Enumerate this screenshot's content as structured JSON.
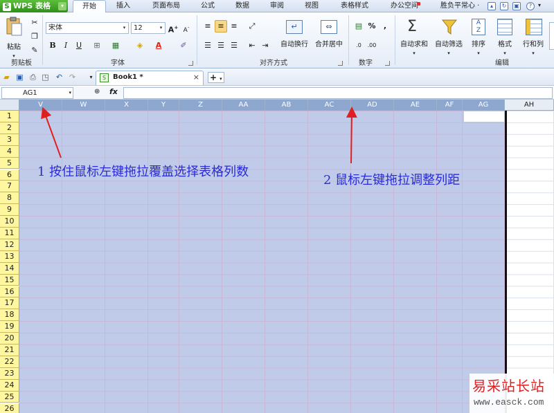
{
  "tabbar": {
    "app_label": "WPS 表格",
    "tabs": [
      "开始",
      "插入",
      "页面布局",
      "公式",
      "数据",
      "审阅",
      "视图",
      "表格样式",
      "办公空间"
    ],
    "user": "胜负平常心 ·"
  },
  "ribbon": {
    "clipboard": {
      "paste": "粘贴",
      "label": "剪贴板"
    },
    "font": {
      "name": "宋体",
      "size": "12",
      "label": "字体",
      "bold": "B",
      "italic": "I",
      "underline": "U",
      "grow": "A",
      "shrink": "A"
    },
    "alignment": {
      "wrap": "自动换行",
      "merge": "合并居中",
      "label": "对齐方式"
    },
    "number": {
      "percent": "%",
      "comma": ",",
      "label": "数字"
    },
    "editing": {
      "autosum": "自动求和",
      "autofilter": "自动筛选",
      "sort": "排序",
      "format": "格式",
      "rowcol": "行和列",
      "label": "编辑"
    }
  },
  "qat": {
    "doc_name": "Book1 *",
    "close": "×",
    "new_tab": "+"
  },
  "formula_bar": {
    "name_box": "AG1",
    "fx": "fx",
    "formula": ""
  },
  "sheet": {
    "columns": [
      "V",
      "W",
      "X",
      "Y",
      "Z",
      "AA",
      "AB",
      "AC",
      "AD",
      "AE",
      "AF",
      "AG",
      "AH"
    ],
    "rows": [
      "1",
      "2",
      "3",
      "4",
      "5",
      "6",
      "7",
      "8",
      "9",
      "10",
      "11",
      "12",
      "13",
      "14",
      "15",
      "16",
      "17",
      "18",
      "19",
      "20",
      "21",
      "22",
      "23",
      "24",
      "25",
      "26"
    ]
  },
  "annotations": {
    "a1": "1 按住鼠标左键拖拉覆盖选择表格列数",
    "a2": "2 鼠标左键拖拉调整列距"
  },
  "watermark": {
    "cn": "易采站长站",
    "url": "www.easck.com"
  },
  "colors": {
    "selection": "#bfcbe8",
    "row_header": "#fff6a0",
    "annotation": "#2a2ad6",
    "arrow": "#e02020",
    "app_button": "#3a9a22"
  }
}
